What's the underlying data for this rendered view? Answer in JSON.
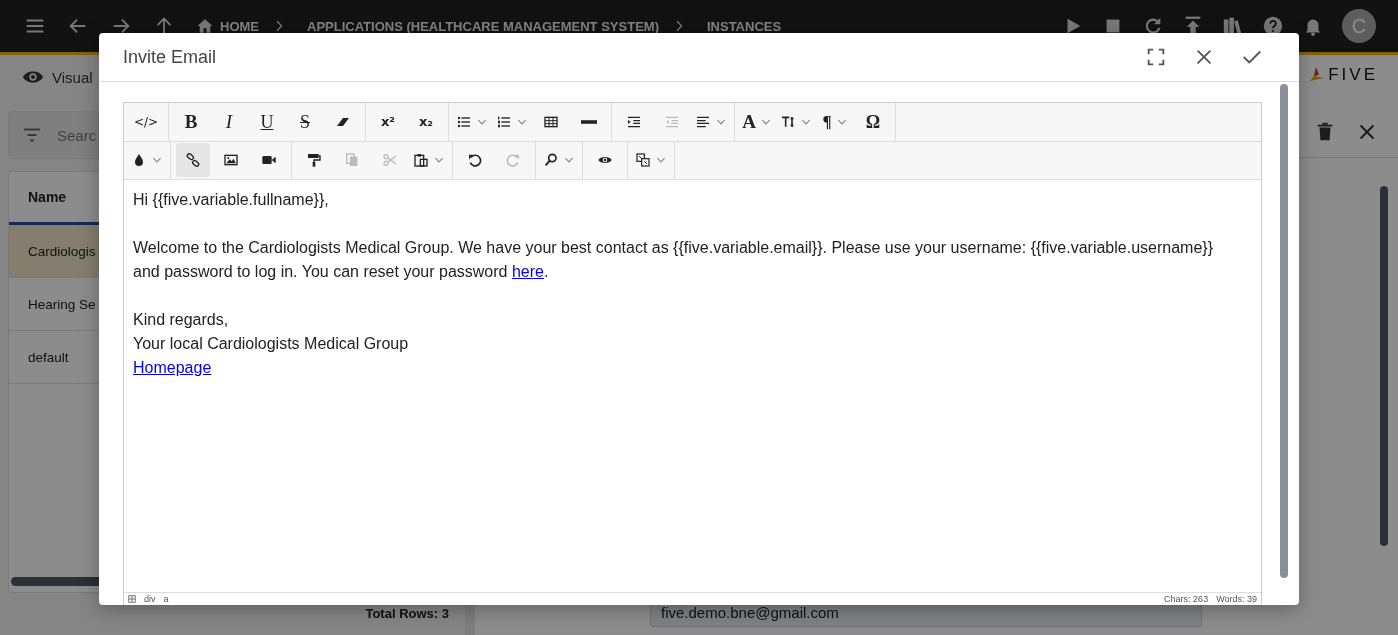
{
  "topbar": {
    "breadcrumbs": [
      {
        "label": "HOME",
        "kind": "home"
      },
      {
        "label": "APPLICATIONS (HEALTHCARE MANAGEMENT SYSTEM)",
        "kind": "plain"
      },
      {
        "label": "INSTANCES",
        "kind": "plain"
      }
    ],
    "avatar": "C"
  },
  "view_selector": {
    "label": "Visual"
  },
  "search": {
    "placeholder": "Searc"
  },
  "list": {
    "columns": [
      "Name"
    ],
    "rows": [
      {
        "name": "Cardiologis",
        "selected": true
      },
      {
        "name": "Hearing Se",
        "selected": false
      },
      {
        "name": "default",
        "selected": false
      }
    ],
    "total": "Total Rows: 3"
  },
  "logo": "FIVE",
  "detail": {
    "email": "five.demo.bne@gmail.com"
  },
  "dialog": {
    "title": "Invite Email",
    "toolbar": [
      [
        [
          {
            "kind": "code",
            "label": "</>",
            "dropdown": false,
            "disabled": false,
            "active": false
          }
        ],
        [
          {
            "kind": "bold",
            "label": "B",
            "dropdown": false,
            "disabled": false,
            "active": false
          },
          {
            "kind": "italic",
            "label": "I",
            "dropdown": false,
            "disabled": false,
            "active": false
          },
          {
            "kind": "underline",
            "label": "U",
            "dropdown": false,
            "disabled": false,
            "active": false
          },
          {
            "kind": "strikethrough",
            "label": "S",
            "dropdown": false,
            "disabled": false,
            "active": false
          },
          {
            "kind": "eraser",
            "dropdown": false,
            "disabled": false,
            "active": false
          }
        ],
        [
          {
            "kind": "superscript",
            "label": "x²",
            "dropdown": false,
            "disabled": false,
            "active": false
          },
          {
            "kind": "subscript",
            "label": "x₂",
            "dropdown": false,
            "disabled": false,
            "active": false
          }
        ],
        [
          {
            "kind": "bullet-list",
            "dropdown": true,
            "disabled": false,
            "active": false
          },
          {
            "kind": "numbered-list",
            "dropdown": true,
            "disabled": false,
            "active": false
          },
          {
            "kind": "table",
            "dropdown": false,
            "disabled": false,
            "active": false
          },
          {
            "kind": "horizontal-line",
            "dropdown": false,
            "disabled": false,
            "active": false
          }
        ],
        [
          {
            "kind": "indent",
            "dropdown": false,
            "disabled": false,
            "active": false
          },
          {
            "kind": "outdent",
            "dropdown": false,
            "disabled": true,
            "active": false
          },
          {
            "kind": "align-left",
            "dropdown": true,
            "disabled": false,
            "active": false
          }
        ],
        [
          {
            "kind": "font",
            "label": "A",
            "dropdown": true,
            "disabled": false,
            "active": false
          },
          {
            "kind": "text-size",
            "dropdown": true,
            "disabled": false,
            "active": false
          },
          {
            "kind": "paragraph",
            "label": "¶",
            "dropdown": true,
            "disabled": false,
            "active": false
          },
          {
            "kind": "symbol",
            "label": "Ω",
            "dropdown": false,
            "disabled": false,
            "active": false
          }
        ]
      ],
      [
        [
          {
            "kind": "drop",
            "dropdown": true,
            "disabled": false,
            "active": false
          }
        ],
        [
          {
            "kind": "link",
            "dropdown": false,
            "disabled": false,
            "active": true
          },
          {
            "kind": "image",
            "dropdown": false,
            "disabled": false,
            "active": false
          },
          {
            "kind": "video",
            "dropdown": false,
            "disabled": false,
            "active": false
          }
        ],
        [
          {
            "kind": "paint-roller",
            "dropdown": false,
            "disabled": false,
            "active": false
          },
          {
            "kind": "copy",
            "dropdown": false,
            "disabled": true,
            "active": false
          },
          {
            "kind": "scissors",
            "dropdown": false,
            "disabled": true,
            "active": false
          },
          {
            "kind": "paste",
            "dropdown": true,
            "disabled": false,
            "active": false
          }
        ],
        [
          {
            "kind": "undo",
            "dropdown": false,
            "disabled": false,
            "active": false
          },
          {
            "kind": "redo",
            "dropdown": false,
            "disabled": true,
            "active": false
          }
        ],
        [
          {
            "kind": "search",
            "dropdown": true,
            "disabled": false,
            "active": false
          }
        ],
        [
          {
            "kind": "eye",
            "dropdown": false,
            "disabled": false,
            "active": false
          }
        ],
        [
          {
            "kind": "template",
            "dropdown": true,
            "disabled": false,
            "active": false
          }
        ]
      ]
    ],
    "body": [
      [
        {
          "kind": "text",
          "text": "Hi {{five.variable.fullname}},"
        }
      ],
      [
        {
          "kind": "text",
          "text": "Welcome to the Cardiologists Medical Group. We have your best contact as {{five.variable.email}}. Please use your username: {{five.variable.username}} and password to log in. You can reset your password ",
          "link": "here",
          "after": "."
        }
      ],
      [
        {
          "kind": "text",
          "text": "Kind regards,"
        },
        {
          "kind": "text",
          "text": "Your local Cardiologists Medical Group"
        },
        {
          "kind": "link",
          "text": "Homepage"
        }
      ]
    ],
    "status": {
      "path": [
        "div",
        "a"
      ],
      "chars": "Chars: 263",
      "words": "Words: 39"
    }
  }
}
